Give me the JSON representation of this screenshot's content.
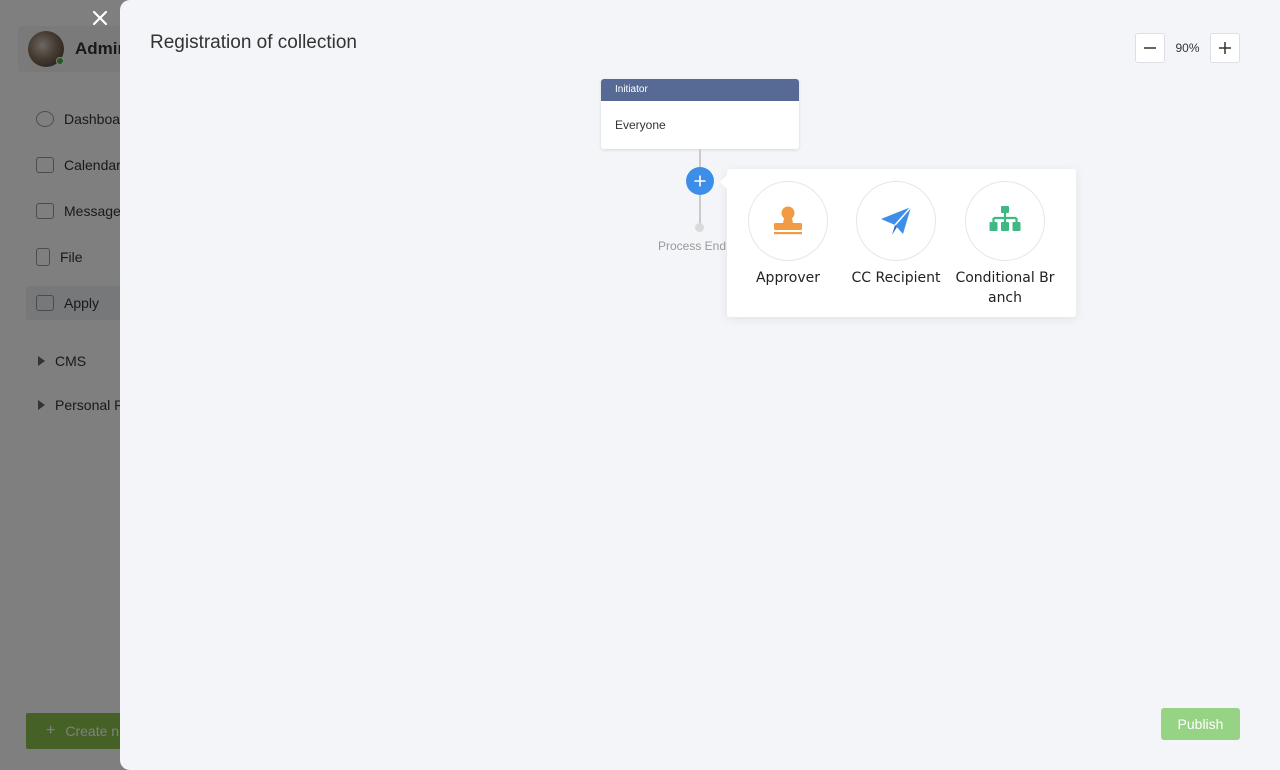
{
  "background": {
    "user_name": "Admin",
    "nav_items": [
      {
        "label": "Dashboard",
        "icon": "dashboard-icon"
      },
      {
        "label": "Calendar",
        "icon": "calendar-icon"
      },
      {
        "label": "Message",
        "icon": "message-icon"
      },
      {
        "label": "File",
        "icon": "file-icon"
      },
      {
        "label": "Apply",
        "icon": "apps-icon"
      }
    ],
    "groups": [
      "CMS",
      "Personal R"
    ],
    "create_label": "Create n"
  },
  "drawer": {
    "title": "Registration of collection",
    "zoom": {
      "value": "90%"
    },
    "initiator": {
      "header": "Initiator",
      "body": "Everyone"
    },
    "process_end_label": "Process End",
    "options": [
      {
        "label": "Approver",
        "icon": "stamp-icon",
        "color": "#f19b44"
      },
      {
        "label": "CC Recipient",
        "icon": "paper-plane-icon",
        "color": "#3d8ee9"
      },
      {
        "label": "Conditional Branch",
        "label_line1": "Conditional Br",
        "label_line2": "anch",
        "icon": "org-chart-icon",
        "color": "#3fb883"
      }
    ],
    "publish_label": "Publish"
  },
  "colors": {
    "accent_blue": "#3d8ee9",
    "initiator_header": "#576a95",
    "publish_green": "#96d384"
  }
}
